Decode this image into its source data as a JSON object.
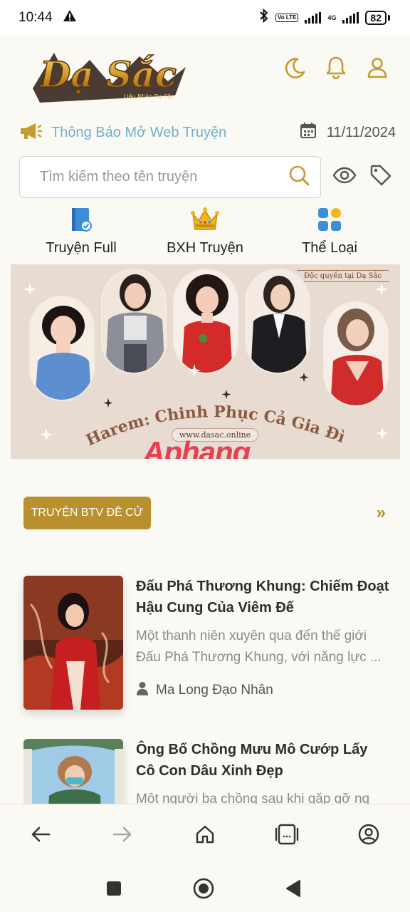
{
  "status_bar": {
    "time": "10:44",
    "network_label": "4G",
    "volte_label": "Vo LTE",
    "battery": "82"
  },
  "header": {
    "logo_text": "Dạ Sắc",
    "logo_subtitle": "Liêu Nhân Dạ Sắc"
  },
  "notice": {
    "text": "Thông Báo Mở Web Truyện",
    "date": "11/11/2024"
  },
  "search": {
    "placeholder": "Tìm kiếm theo tên truyện"
  },
  "quick_links": [
    {
      "label": "Truyện Full"
    },
    {
      "label": "BXH Truyện"
    },
    {
      "label": "Thể Loại"
    }
  ],
  "banner": {
    "tag": "Độc quyền tại Dạ Sắc",
    "title": "Harem: Chinh Phục Cả Gia Đình",
    "url": "www.dasac.online",
    "watermark": "Aphang"
  },
  "section": {
    "title": "TRUYỆN BTV ĐỀ CỬ",
    "more": "»"
  },
  "stories": [
    {
      "title": "Đấu Phá Thương Khung: Chiếm Đoạt Hậu Cung Của Viêm Đế",
      "description": "Một thanh niên xuyên qua đến thế giới Đấu Phá Thương Khung, với năng lực ...",
      "author": "Ma Long Đạo Nhân"
    },
    {
      "title": "Ông Bố Chồng Mưu Mô Cướp Lấy Cô Con Dâu Xinh Đẹp",
      "description": "Một người ba chồng sau khi gặp gỡ ng"
    }
  ],
  "colors": {
    "accent_gold": "#b8902e",
    "notice_blue": "#6fb2c9",
    "background": "#fbf9f4"
  }
}
